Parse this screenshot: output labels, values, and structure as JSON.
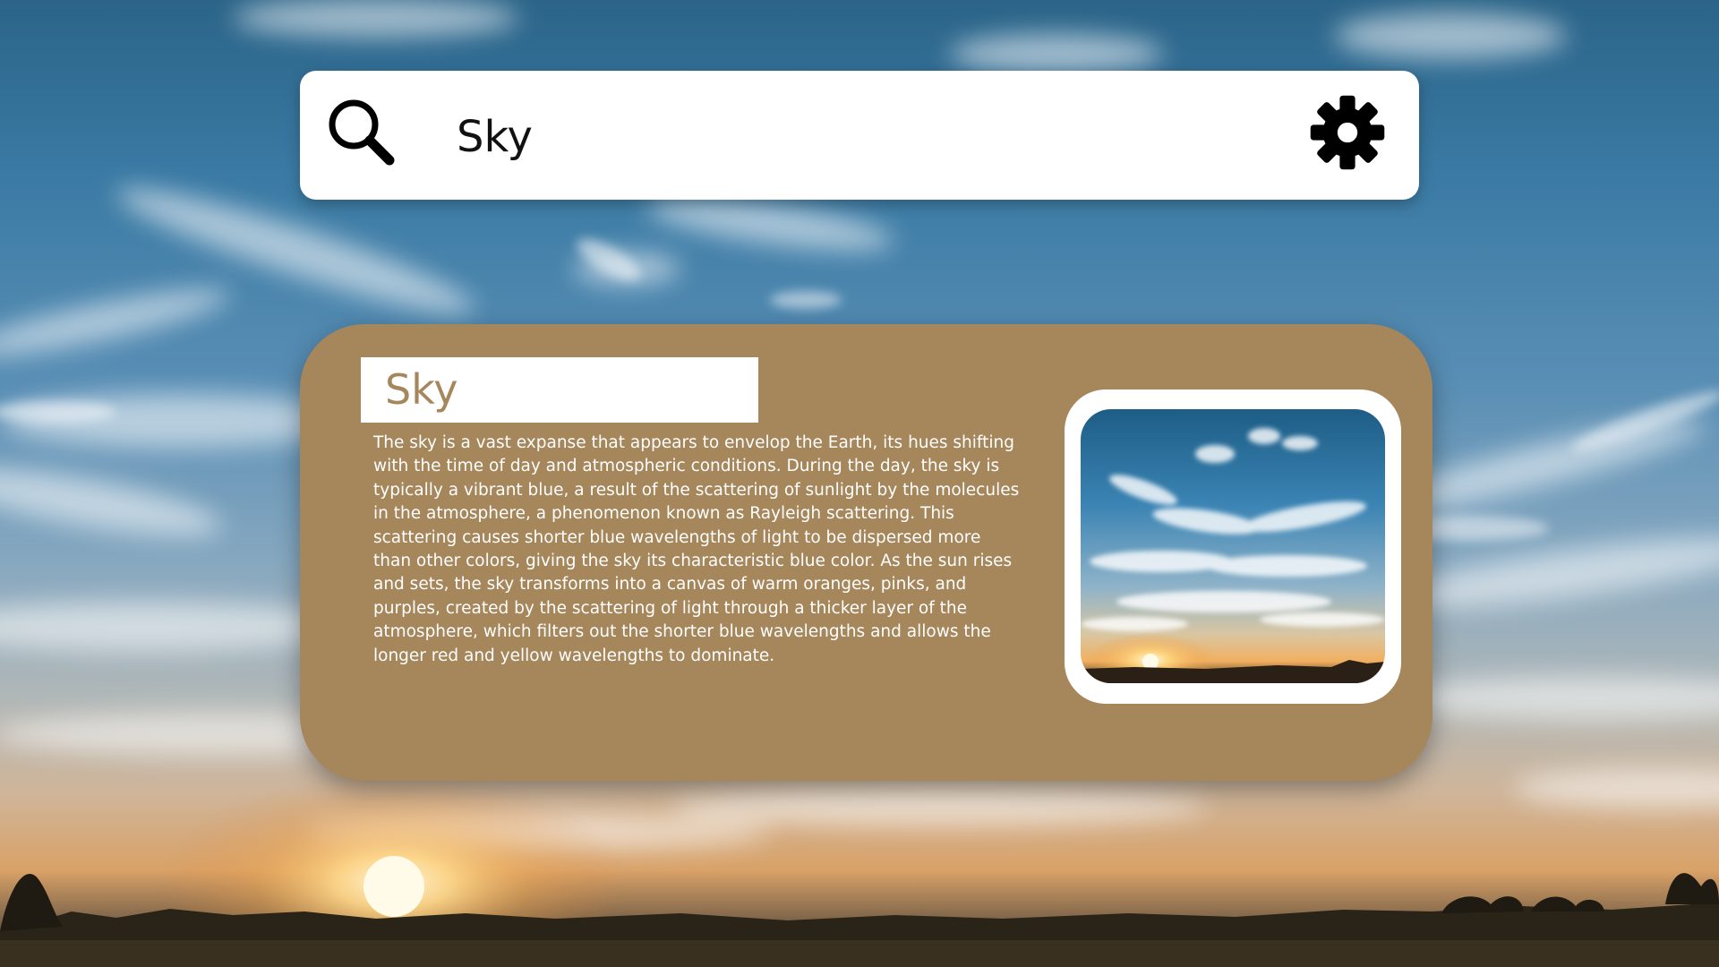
{
  "search": {
    "query": "Sky",
    "search_icon": "search-icon",
    "settings_icon": "gear-icon"
  },
  "result": {
    "title": "Sky",
    "description": "The sky is a vast expanse that appears to envelop the Earth, its hues shifting with the time of day and atmospheric conditions. During the day, the sky is typically a vibrant blue, a result of the scattering of sunlight by the molecules in the atmosphere, a phenomenon known as Rayleigh scattering. This scattering causes shorter blue wavelengths of light to be dispersed more than other colors, giving the sky its characteristic blue color. As the sun rises and sets, the sky transforms into a canvas of warm oranges, pinks, and purples, created by the scattering of light through a thicker layer of the atmosphere, which filters out the shorter blue wavelengths and allows the longer red and yellow wavelengths to dominate."
  },
  "colors": {
    "card_background": "#a6865b",
    "title_text": "#a6865b",
    "search_background": "#ffffff"
  }
}
